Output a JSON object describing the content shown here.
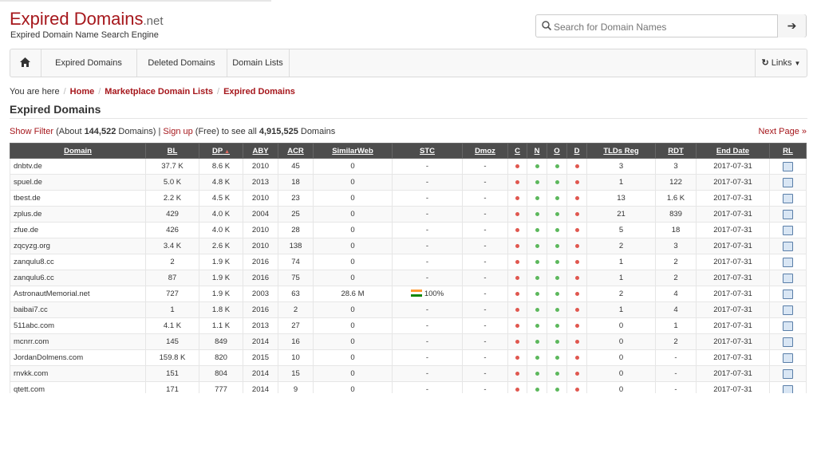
{
  "header": {
    "logo_main": "Expired",
    "logo_domains": " Domains",
    "logo_tld": ".net",
    "tagline": "Expired Domain Name Search Engine",
    "search_placeholder": "Search for Domain Names",
    "search_icon": "search-icon",
    "go_icon": "arrow-right-icon"
  },
  "nav": {
    "home_icon": "home-icon",
    "items": [
      "Expired Domains",
      "Deleted Domains",
      "Domain Lists"
    ],
    "links_label": "Links"
  },
  "breadcrumb": {
    "prefix": "You are here",
    "items": [
      "Home",
      "Marketplace Domain Lists",
      "Expired Domains"
    ]
  },
  "page_title": "Expired Domains",
  "filter": {
    "show_filter": "Show Filter",
    "about_pre": " (About ",
    "count": "144,522",
    "about_post": " Domains) | ",
    "signup": "Sign up",
    "free_text": " (Free) to see all ",
    "total": "4,915,525",
    "total_post": " Domains",
    "next_page": "Next Page »"
  },
  "colors": {
    "brand": "#a6171c",
    "header_bg": "#4d4d4d",
    "status_red": "#e0574f",
    "status_green": "#5cb85c"
  },
  "table": {
    "columns": [
      "Domain",
      "BL",
      "DP",
      "ABY",
      "ACR",
      "SimilarWeb",
      "STC",
      "Dmoz",
      "C",
      "N",
      "O",
      "D",
      "TLDs Reg",
      "RDT",
      "End Date",
      "RL"
    ],
    "rows": [
      {
        "domain": "dnbtv.de",
        "bl": "37.7 K",
        "dp": "8.6 K",
        "aby": "2010",
        "acr": "45",
        "sw": "0",
        "stc": "-",
        "dmoz": "-",
        "c": "r",
        "n": "g",
        "o": "g",
        "d": "r",
        "tlds": "3",
        "rdt": "3",
        "end": "2017-07-31"
      },
      {
        "domain": "spuel.de",
        "bl": "5.0 K",
        "dp": "4.8 K",
        "aby": "2013",
        "acr": "18",
        "sw": "0",
        "stc": "-",
        "dmoz": "-",
        "c": "r",
        "n": "g",
        "o": "g",
        "d": "r",
        "tlds": "1",
        "rdt": "122",
        "end": "2017-07-31"
      },
      {
        "domain": "tbest.de",
        "bl": "2.2 K",
        "dp": "4.5 K",
        "aby": "2010",
        "acr": "23",
        "sw": "0",
        "stc": "-",
        "dmoz": "-",
        "c": "r",
        "n": "g",
        "o": "g",
        "d": "r",
        "tlds": "13",
        "rdt": "1.6 K",
        "end": "2017-07-31"
      },
      {
        "domain": "zplus.de",
        "bl": "429",
        "dp": "4.0 K",
        "aby": "2004",
        "acr": "25",
        "sw": "0",
        "stc": "-",
        "dmoz": "-",
        "c": "r",
        "n": "g",
        "o": "g",
        "d": "r",
        "tlds": "21",
        "rdt": "839",
        "end": "2017-07-31"
      },
      {
        "domain": "zfue.de",
        "bl": "426",
        "dp": "4.0 K",
        "aby": "2010",
        "acr": "28",
        "sw": "0",
        "stc": "-",
        "dmoz": "-",
        "c": "r",
        "n": "g",
        "o": "g",
        "d": "r",
        "tlds": "5",
        "rdt": "18",
        "end": "2017-07-31"
      },
      {
        "domain": "zqcyzg.org",
        "bl": "3.4 K",
        "dp": "2.6 K",
        "aby": "2010",
        "acr": "138",
        "sw": "0",
        "stc": "-",
        "dmoz": "-",
        "c": "r",
        "n": "g",
        "o": "g",
        "d": "r",
        "tlds": "2",
        "rdt": "3",
        "end": "2017-07-31"
      },
      {
        "domain": "zanqulu8.cc",
        "bl": "2",
        "dp": "1.9 K",
        "aby": "2016",
        "acr": "74",
        "sw": "0",
        "stc": "-",
        "dmoz": "-",
        "c": "r",
        "n": "g",
        "o": "g",
        "d": "r",
        "tlds": "1",
        "rdt": "2",
        "end": "2017-07-31"
      },
      {
        "domain": "zanqulu6.cc",
        "bl": "87",
        "dp": "1.9 K",
        "aby": "2016",
        "acr": "75",
        "sw": "0",
        "stc": "-",
        "dmoz": "-",
        "c": "r",
        "n": "g",
        "o": "g",
        "d": "r",
        "tlds": "1",
        "rdt": "2",
        "end": "2017-07-31"
      },
      {
        "domain": "AstronautMemorial.net",
        "bl": "727",
        "dp": "1.9 K",
        "aby": "2003",
        "acr": "63",
        "sw": "28.6 M",
        "stc": "100%",
        "dmoz": "-",
        "c": "r",
        "n": "g",
        "o": "g",
        "d": "r",
        "tlds": "2",
        "rdt": "4",
        "end": "2017-07-31",
        "flag": true
      },
      {
        "domain": "baibai7.cc",
        "bl": "1",
        "dp": "1.8 K",
        "aby": "2016",
        "acr": "2",
        "sw": "0",
        "stc": "-",
        "dmoz": "-",
        "c": "r",
        "n": "g",
        "o": "g",
        "d": "r",
        "tlds": "1",
        "rdt": "4",
        "end": "2017-07-31"
      },
      {
        "domain": "511abc.com",
        "bl": "4.1 K",
        "dp": "1.1 K",
        "aby": "2013",
        "acr": "27",
        "sw": "0",
        "stc": "-",
        "dmoz": "-",
        "c": "r",
        "n": "g",
        "o": "g",
        "d": "r",
        "tlds": "0",
        "rdt": "1",
        "end": "2017-07-31"
      },
      {
        "domain": "mcnrr.com",
        "bl": "145",
        "dp": "849",
        "aby": "2014",
        "acr": "16",
        "sw": "0",
        "stc": "-",
        "dmoz": "-",
        "c": "r",
        "n": "g",
        "o": "g",
        "d": "r",
        "tlds": "0",
        "rdt": "2",
        "end": "2017-07-31"
      },
      {
        "domain": "JordanDolmens.com",
        "bl": "159.8 K",
        "dp": "820",
        "aby": "2015",
        "acr": "10",
        "sw": "0",
        "stc": "-",
        "dmoz": "-",
        "c": "r",
        "n": "g",
        "o": "g",
        "d": "r",
        "tlds": "0",
        "rdt": "-",
        "end": "2017-07-31"
      },
      {
        "domain": "rnvkk.com",
        "bl": "151",
        "dp": "804",
        "aby": "2014",
        "acr": "15",
        "sw": "0",
        "stc": "-",
        "dmoz": "-",
        "c": "r",
        "n": "g",
        "o": "g",
        "d": "r",
        "tlds": "0",
        "rdt": "-",
        "end": "2017-07-31"
      },
      {
        "domain": "qtett.com",
        "bl": "171",
        "dp": "777",
        "aby": "2014",
        "acr": "9",
        "sw": "0",
        "stc": "-",
        "dmoz": "-",
        "c": "r",
        "n": "g",
        "o": "g",
        "d": "r",
        "tlds": "0",
        "rdt": "-",
        "end": "2017-07-31"
      }
    ]
  }
}
